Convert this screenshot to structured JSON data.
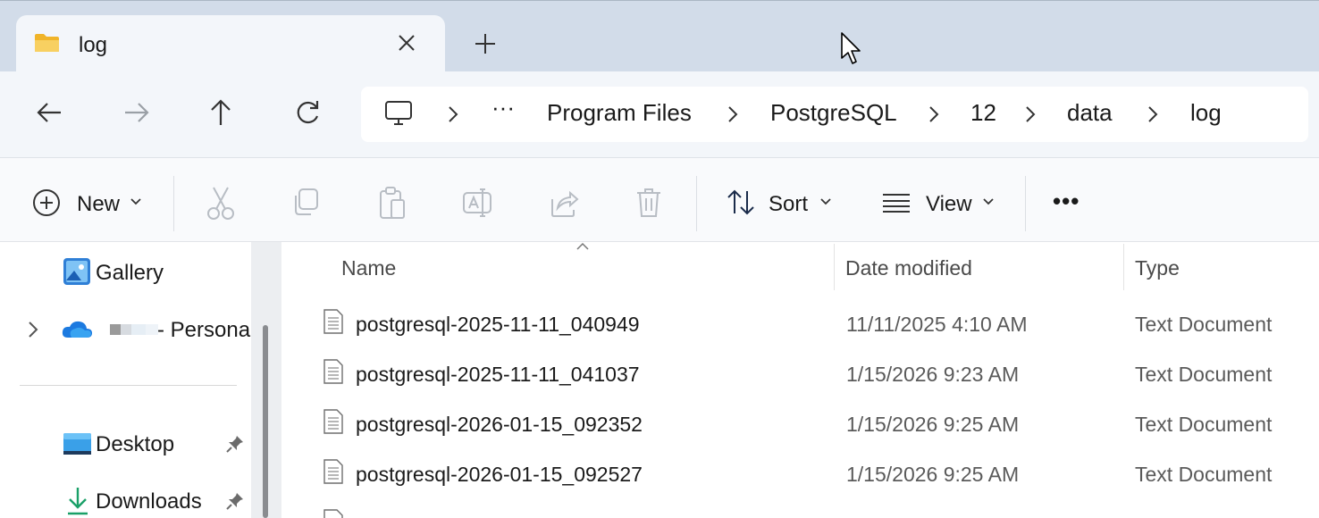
{
  "tab": {
    "title": "log",
    "folder_icon": "folder-icon",
    "close_icon": "close-icon",
    "new_tab_icon": "plus-icon"
  },
  "nav": {
    "back_icon": "arrow-left-icon",
    "forward_icon": "arrow-right-icon",
    "up_icon": "arrow-up-icon",
    "refresh_icon": "refresh-icon"
  },
  "address": {
    "root_icon": "this-pc-icon",
    "overflow": "···",
    "crumbs": [
      "Program Files",
      "PostgreSQL",
      "12",
      "data",
      "log"
    ]
  },
  "toolbar": {
    "new_label": "New",
    "sort_label": "Sort",
    "view_label": "View",
    "more_label": "•••"
  },
  "sidebar": {
    "items": [
      {
        "label": "Gallery",
        "icon": "gallery-icon"
      },
      {
        "label": "- Personal",
        "icon": "onedrive-icon"
      },
      {
        "label": "Desktop",
        "icon": "desktop-icon"
      },
      {
        "label": "Downloads",
        "icon": "downloads-icon"
      }
    ]
  },
  "filelist": {
    "columns": {
      "name": "Name",
      "date": "Date modified",
      "type": "Type"
    },
    "rows": [
      {
        "name": "postgresql-2025-11-11_040949",
        "date": "11/11/2025 4:10 AM",
        "type": "Text Document"
      },
      {
        "name": "postgresql-2025-11-11_041037",
        "date": "1/15/2026 9:23 AM",
        "type": "Text Document"
      },
      {
        "name": "postgresql-2026-01-15_092352",
        "date": "1/15/2026 9:25 AM",
        "type": "Text Document"
      },
      {
        "name": "postgresql-2026-01-15_092527",
        "date": "1/15/2026 9:25 AM",
        "type": "Text Document"
      }
    ]
  },
  "colors": {
    "tabstrip": "#d2dce9",
    "accent": "#1a73c8",
    "folder": "#f6c744"
  }
}
